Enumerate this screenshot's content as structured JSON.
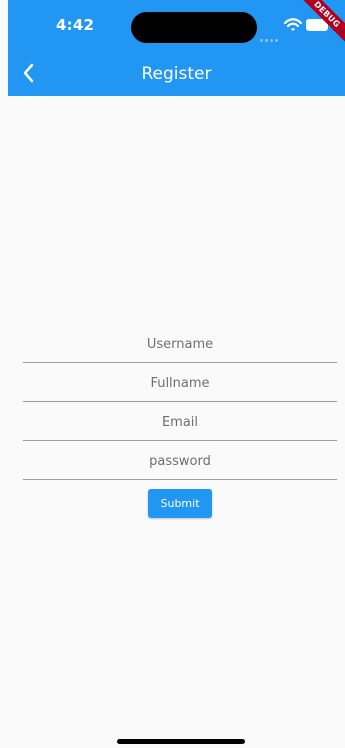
{
  "status_bar": {
    "time": "4:42",
    "debug_label": "DEBUG"
  },
  "app_bar": {
    "title": "Register",
    "back_icon": "chevron-left-icon"
  },
  "form": {
    "fields": [
      {
        "name": "username",
        "placeholder": "Username",
        "value": ""
      },
      {
        "name": "fullname",
        "placeholder": "Fullname",
        "value": ""
      },
      {
        "name": "email",
        "placeholder": "Email",
        "value": ""
      },
      {
        "name": "password",
        "placeholder": "password",
        "value": ""
      }
    ],
    "submit_label": "Submit"
  },
  "colors": {
    "primary": "#2196f3",
    "background": "#fafafa",
    "debug_ribbon": "#b00020"
  }
}
